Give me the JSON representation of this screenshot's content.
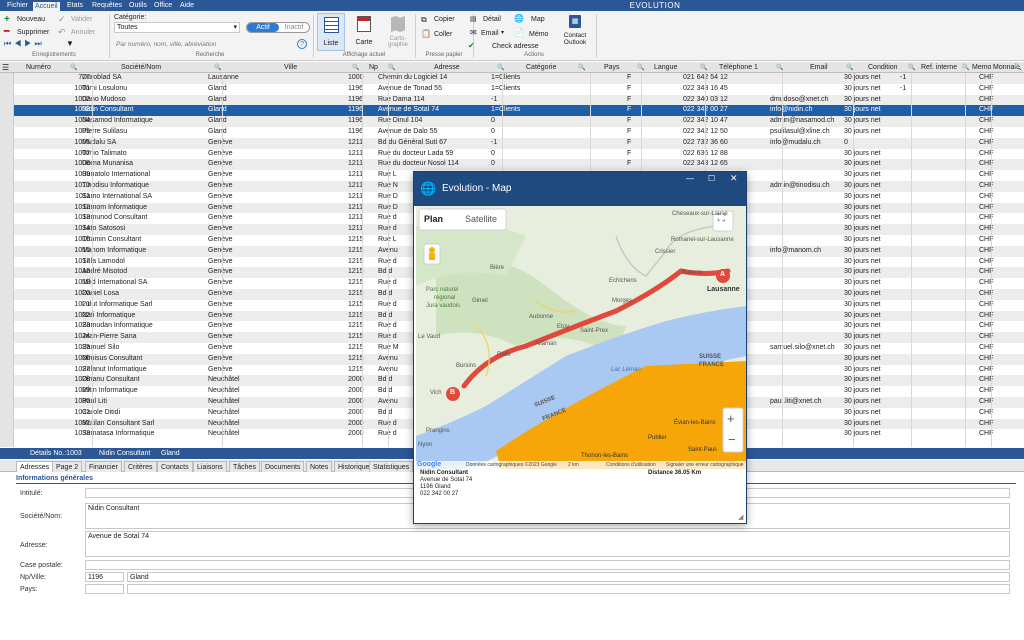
{
  "menu": {
    "items": [
      "Fichier",
      "Accueil",
      "Etats",
      "Requêtes",
      "Outils",
      "Office",
      "Aide"
    ],
    "active": "Accueil",
    "app_title": "EVOLUTION"
  },
  "ribbon": {
    "nouveau": "Nouveau",
    "valider": "Valider",
    "supprimer": "Supprimer",
    "annuler": "Annuler",
    "group_enregistrements": "Enregistrements",
    "categorie_label": "Catégorie:",
    "categorie_value": "Toutes",
    "actif": "Actif",
    "inactif": "Inactif",
    "search_placeholder": "Par numéro, nom, ville, abréviation",
    "group_recherche": "Recherche",
    "liste": "Liste",
    "carte": "Carte",
    "cartographie": "Carto-\ngraphie",
    "group_affichage": "Affichage actuel",
    "copier": "Copier",
    "coller": "Coller",
    "group_presse": "Presse papier",
    "detail": "Détail",
    "map": "Map",
    "email": "Email",
    "memo": "Mémo",
    "check_adresse": "Check adresse",
    "contact_outlook": "Contact\nOutlook",
    "group_actions": "Actions"
  },
  "table": {
    "columns": [
      "Numéro",
      "Société/Nom",
      "Ville",
      "Np",
      "Adresse",
      "Catégorie",
      "Pays",
      "Langue",
      "Téléphone 1",
      "Email",
      "Condition",
      "Ref. interne",
      "Memo",
      "Monnaie"
    ],
    "rows": [
      [
        "777",
        "Duroblad SA",
        "Lausanne",
        "1000",
        "Chemin du Logiciel 14",
        "1=Clients",
        "",
        "F",
        "021 642 54 12",
        "",
        "30 jours net",
        "-1",
        "",
        "CHF"
      ],
      [
        "1001",
        "Tomi Losulonu",
        "Gland",
        "1196",
        "Avenue de Tonad 55",
        "1=Clients",
        "",
        "F",
        "022 343 16 45",
        "",
        "30 jours net",
        "-1",
        "",
        "CHF"
      ],
      [
        "1002",
        "Dano Mudoso",
        "Gland",
        "1196",
        "Rue Dama 114",
        "-1",
        "",
        "F",
        "022 340 03 12",
        "dmudoso@xnet.ch",
        "30 jours net",
        "",
        "",
        "CHF"
      ],
      [
        "1003",
        "Nidin Consultant",
        "Gland",
        "1196",
        "Avenue de Sotal  74",
        "1=Clients",
        "",
        "F",
        "022 342 00 27",
        "info@nidin.ch",
        "30 jours net",
        "",
        "",
        "CHF"
      ],
      [
        "1004",
        "Nasamod Informatique",
        "Gland",
        "1196",
        "Rue Dinul 104",
        "0",
        "",
        "F",
        "022 342 10 47",
        "admin@nasamod.ch",
        "30 jours net",
        "",
        "",
        "CHF"
      ],
      [
        "1005",
        "Pierre Sulilasu",
        "Gland",
        "1196",
        "Avenue de Dalo 55",
        "0",
        "",
        "F",
        "022 342 12 50",
        "psulilasul@xline.ch",
        "30 jours net",
        "",
        "",
        "CHF"
      ],
      [
        "1006",
        "Mudalu SA",
        "Genève",
        "1211",
        "Bd du Général Suti 67",
        "-1",
        "",
        "F",
        "022 732 36 60",
        "info@mudalu.ch",
        "0",
        "",
        "",
        "CHF"
      ],
      [
        "1007",
        "Tonio Talimato",
        "Genève",
        "1211",
        "Rue du docteur Lada 59",
        "0",
        "",
        "F",
        "022 636 12 88",
        "",
        "30 jours net",
        "",
        "",
        "CHF"
      ],
      [
        "1008",
        "Doma Munanisa",
        "Genève",
        "1211",
        "Rue du docteur Nosol 114",
        "0",
        "",
        "F",
        "022 343 12 65",
        "",
        "30 jours net",
        "",
        "",
        "CHF"
      ],
      [
        "1009",
        "Sunatolo International",
        "Genève",
        "1211",
        "Rue L",
        "",
        "",
        "",
        "",
        "",
        "30 jours net",
        "",
        "",
        "CHF"
      ],
      [
        "1010",
        "Tinodisu Informatique",
        "Genève",
        "1211",
        "Rue N",
        "",
        "",
        "",
        "",
        "admin@tinodisu.ch",
        "30 jours net",
        "",
        "",
        "CHF"
      ],
      [
        "1011",
        "Samo International SA",
        "Genève",
        "1211",
        "Rue D",
        "",
        "",
        "",
        "",
        "",
        "30 jours net",
        "",
        "",
        "CHF"
      ],
      [
        "1012",
        "Sumom Informatique",
        "Genève",
        "1211",
        "Rue D",
        "",
        "",
        "",
        "",
        "",
        "30 jours net",
        "",
        "",
        "CHF"
      ],
      [
        "1013",
        "Sumunod Consultant",
        "Genève",
        "1211",
        "Rue d",
        "",
        "",
        "",
        "",
        "",
        "30 jours net",
        "",
        "",
        "CHF"
      ],
      [
        "1014",
        "Sato Satososi",
        "Genève",
        "1211",
        "Rue d",
        "",
        "",
        "",
        "",
        "",
        "30 jours net",
        "",
        "",
        "CHF"
      ],
      [
        "1015",
        "Ditamin Consultant",
        "Genève",
        "1215",
        "Rue L",
        "",
        "",
        "",
        "",
        "",
        "30 jours net",
        "",
        "",
        "CHF"
      ],
      [
        "1016",
        "Manom Informatique",
        "Genève",
        "1215",
        "Avenu",
        "",
        "",
        "",
        "",
        "info@manom.ch",
        "30 jours net",
        "",
        "",
        "CHF"
      ],
      [
        "1017",
        "Sula Lamodol",
        "Genève",
        "1215",
        "Rue d",
        "",
        "",
        "",
        "",
        "",
        "30 jours net",
        "",
        "",
        "CHF"
      ],
      [
        "1018",
        "André Misotod",
        "Genève",
        "1215",
        "Bd d",
        "",
        "",
        "",
        "",
        "",
        "30 jours net",
        "",
        "",
        "CHF"
      ],
      [
        "1019",
        "Nilid International SA",
        "Genève",
        "1215",
        "Rue d",
        "",
        "",
        "",
        "",
        "",
        "30 jours net",
        "",
        "",
        "CHF"
      ],
      [
        "1020",
        "Daniel Losa",
        "Genève",
        "1215",
        "Bd d",
        "",
        "",
        "",
        "",
        "",
        "30 jours net",
        "",
        "",
        "CHF"
      ],
      [
        "1021",
        "Lulut Informatique Sarl",
        "Genève",
        "1215",
        "Rue d",
        "",
        "",
        "",
        "",
        "",
        "30 jours net",
        "",
        "",
        "CHF"
      ],
      [
        "1022",
        "Nati Informatique",
        "Genève",
        "1215",
        "Bd d",
        "",
        "",
        "",
        "",
        "",
        "30 jours net",
        "",
        "",
        "CHF"
      ],
      [
        "1023",
        "Sumudan Informatique",
        "Genève",
        "1215",
        "Rue d",
        "",
        "",
        "",
        "",
        "",
        "30 jours net",
        "",
        "",
        "CHF"
      ],
      [
        "1024",
        "Jean-Pierre Sana",
        "Genève",
        "1215",
        "Rue d",
        "",
        "",
        "",
        "",
        "",
        "30 jours net",
        "",
        "",
        "CHF"
      ],
      [
        "1025",
        "Samuel Silo",
        "Genève",
        "1215",
        "Rue M",
        "",
        "",
        "",
        "",
        "samuel.silo@xnet.ch",
        "30 jours net",
        "",
        "",
        "CHF"
      ],
      [
        "1026",
        "Nimisus Consultant",
        "Genève",
        "1215",
        "Avenu",
        "",
        "",
        "",
        "",
        "",
        "30 jours net",
        "",
        "",
        "CHF"
      ],
      [
        "1027",
        "Sulanut Informatique",
        "Genève",
        "1215",
        "Avenu",
        "",
        "",
        "",
        "",
        "",
        "30 jours net",
        "",
        "",
        "CHF"
      ],
      [
        "1028",
        "Dinanu Consultant",
        "Neuchâtel",
        "2000",
        "Bd d",
        "",
        "",
        "",
        "",
        "",
        "30 jours net",
        "",
        "",
        "CHF"
      ],
      [
        "1029",
        "Mitin Informatique",
        "Neuchâtel",
        "2000",
        "Bd d",
        "",
        "",
        "",
        "",
        "",
        "30 jours net",
        "",
        "",
        "CHF"
      ],
      [
        "1030",
        "Paul Liti",
        "Neuchâtel",
        "2000",
        "Avenu",
        "",
        "",
        "",
        "",
        "paul.liti@xnet.ch",
        "30 jours net",
        "",
        "",
        "CHF"
      ],
      [
        "1031",
        "Carole Ditidi",
        "Neuchâtel",
        "2000",
        "Bd d",
        "",
        "",
        "",
        "",
        "",
        "30 jours net",
        "",
        "",
        "CHF"
      ],
      [
        "1032",
        "Mutilan Consultant Sarl",
        "Neuchâtel",
        "2000",
        "Rue d",
        "",
        "",
        "",
        "",
        "",
        "30 jours net",
        "",
        "",
        "CHF"
      ],
      [
        "1033",
        "Sumatasa Informatique",
        "Neuchâtel",
        "2000",
        "Rue d",
        "",
        "",
        "",
        "",
        "",
        "30 jours net",
        "",
        "",
        "CHF"
      ]
    ]
  },
  "details_bar": {
    "label": "Détails No.:1003",
    "name": "Nidin Consultant",
    "city": "Gland"
  },
  "tabs": [
    "Adresses",
    "Page 2",
    "Financier",
    "Critères",
    "Contacts",
    "Liaisons",
    "Tâches",
    "Documents",
    "Notes",
    "Historique",
    "Statistiques"
  ],
  "form": {
    "section": "Informations générales",
    "intitule_label": "Intitulé:",
    "societe_label": "Société/Nom:",
    "societe_value": "Nidin Consultant",
    "adresse_label": "Adresse:",
    "adresse_value": "Avenue de Sotal  74",
    "case_label": "Case postale:",
    "npville_label": "Np/Ville:",
    "np_value": "1196",
    "ville_value": "Gland",
    "pays_label": "Pays:"
  },
  "map_window": {
    "title": "Evolution - Map",
    "plan": "Plan",
    "satellite": "Satellite",
    "places": [
      "Cheseaux-sur-Lause",
      "Romanel-sur-Lausanne",
      "Crissier",
      "Renens",
      "Lausanne",
      "Echichens",
      "Morges",
      "Bière",
      "Gimel",
      "Parc naturel",
      "régional",
      "Jura vaudois",
      "Aubonne",
      "Etoy",
      "Saint-Prex",
      "Allaman",
      "Le Vaud",
      "Rolle",
      "Bursins",
      "Vich",
      "Prangins",
      "Nyon",
      "SUISSE",
      "FRANCE",
      "Lac Léman",
      "SUISSE",
      "FRANCE",
      "Évian-les-Bains",
      "Publier",
      "Thonon-les-Bains",
      "Saint-Paul-"
    ],
    "marker_a": "A",
    "marker_b": "B",
    "attribution": "Données cartographiques ©2023 Google",
    "scale": "2 km",
    "terms": "Conditions d'utilisation",
    "report": "Signaler une erreur cartographique",
    "info_name": "Nidin Consultant",
    "info_addr": "Avenue de Sotal  74",
    "info_city": "1196 Gland",
    "info_tel": "022 342 00 27",
    "distance": "Distance 36.05 Km"
  }
}
